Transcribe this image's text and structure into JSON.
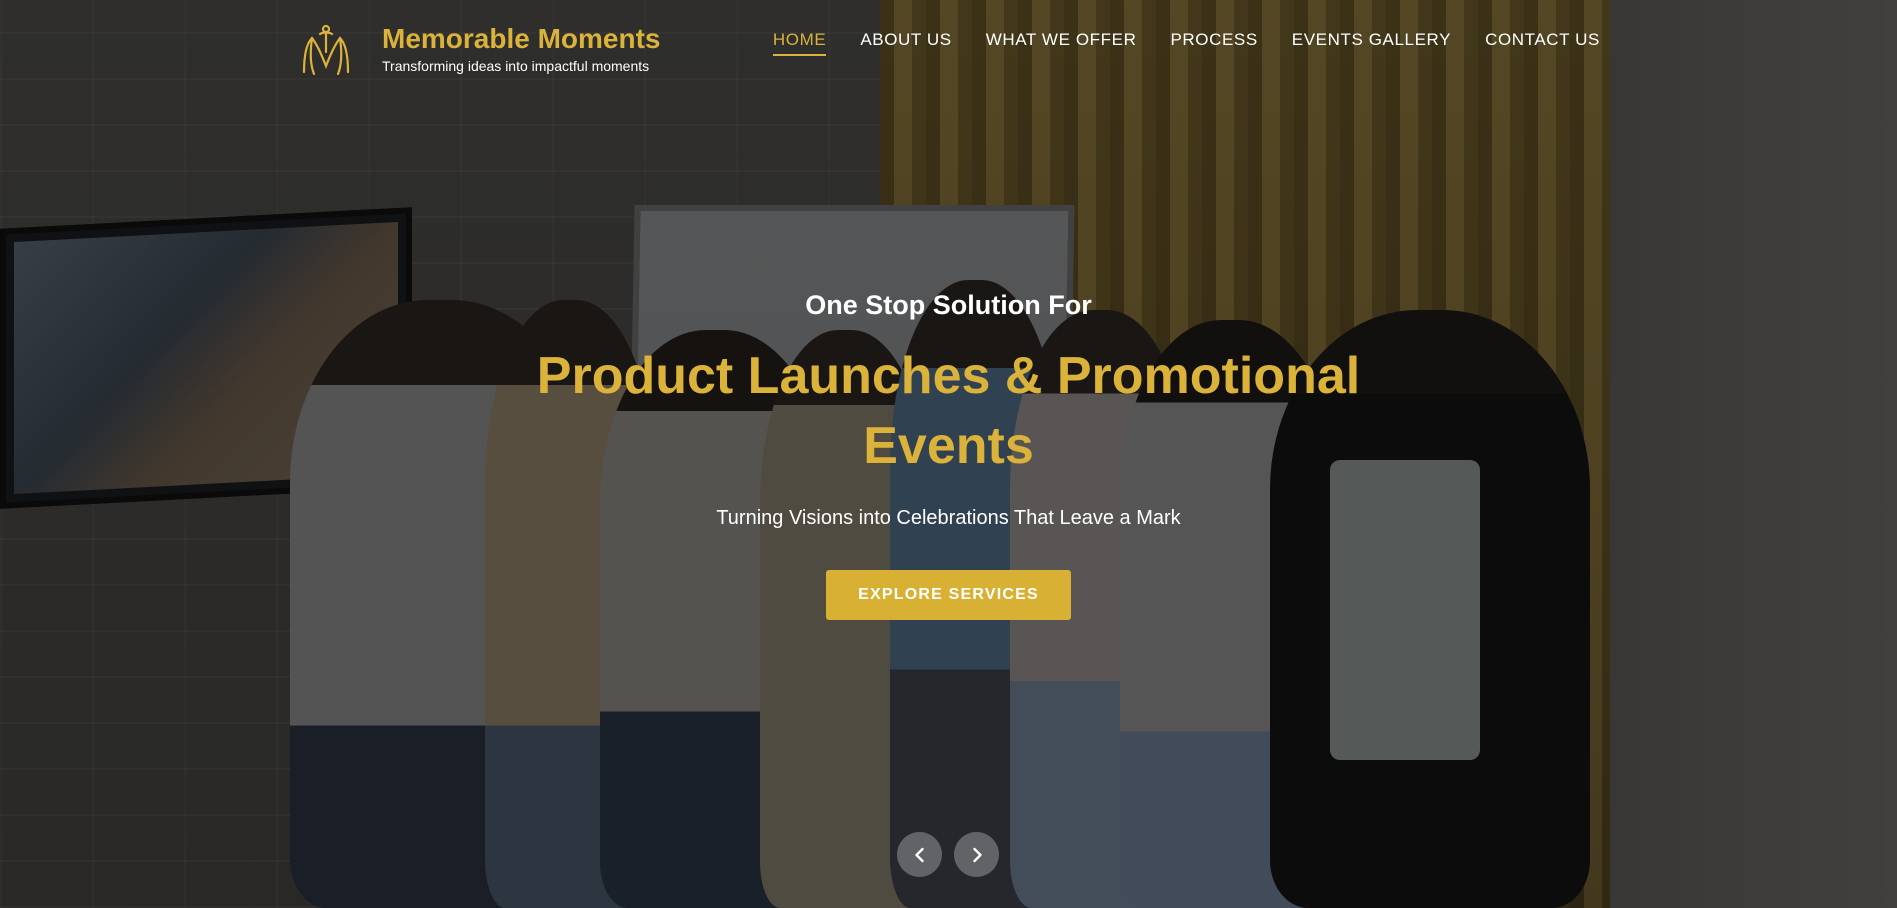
{
  "brand": {
    "name": "Memorable Moments",
    "tagline": "Transforming ideas into impactful moments",
    "accent_color": "#dbb23a"
  },
  "nav": {
    "items": [
      {
        "label": "HOME",
        "active": true
      },
      {
        "label": "ABOUT US",
        "active": false
      },
      {
        "label": "WHAT WE OFFER",
        "active": false
      },
      {
        "label": "PROCESS",
        "active": false
      },
      {
        "label": "EVENTS GALLERY",
        "active": false
      },
      {
        "label": "CONTACT US",
        "active": false
      }
    ]
  },
  "hero": {
    "pre_heading": "One Stop Solution For",
    "heading": "Product Launches & Promotional Events",
    "subheading": "Turning Visions into Celebrations That Leave a Mark",
    "cta_label": "EXPLORE SERVICES",
    "cta_color": "#d8b134"
  },
  "carousel": {
    "prev_icon": "chevron-left-icon",
    "next_icon": "chevron-right-icon"
  }
}
